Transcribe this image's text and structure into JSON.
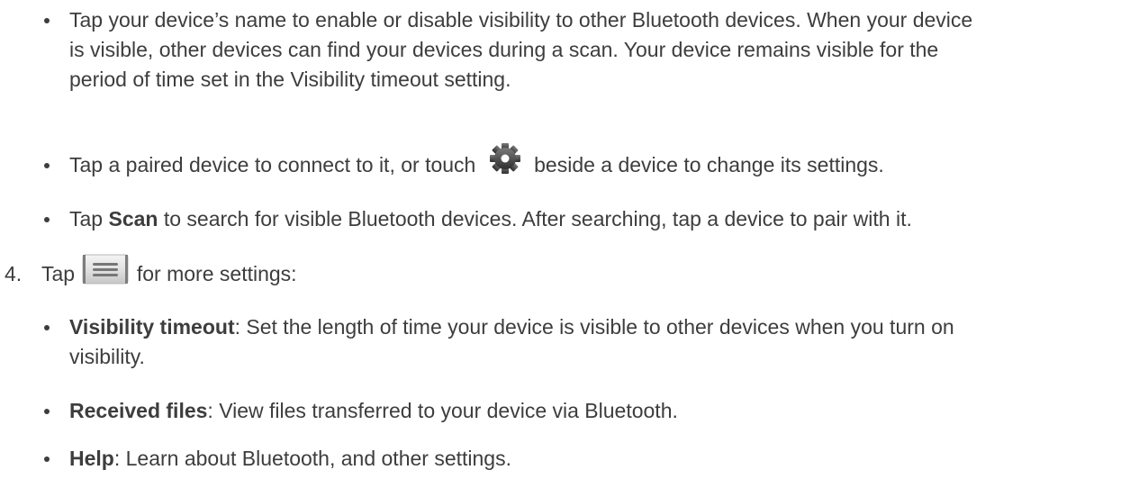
{
  "bullets_top": [
    {
      "text": "Tap your device’s name to enable or disable visibility to other Bluetooth devices. When your device is visible, other devices can find your devices during a scan. Your device remains visible for the period of time set in the Visibility timeout setting."
    },
    {
      "before_icon": "Tap a paired device to connect to it, or touch",
      "icon": "gear-icon",
      "after_icon": "beside a device to change its settings."
    },
    {
      "prefix": "Tap",
      "bold": "Scan",
      "suffix": "to search for visible Bluetooth devices. After searching, tap a device to pair with it."
    }
  ],
  "step4": {
    "number": "4.",
    "before_icon": "Tap",
    "icon": "menu-icon",
    "after_icon": "for more settings:"
  },
  "sub_bullets": [
    {
      "bold": "Visibility timeout",
      "text": ": Set the length of time your device is visible to other devices when you turn on visibility."
    },
    {
      "bold": "Received files",
      "text": ": View files transferred to your device via Bluetooth."
    },
    {
      "bold": "Help",
      "text": ": Learn about Bluetooth, and other settings."
    }
  ]
}
